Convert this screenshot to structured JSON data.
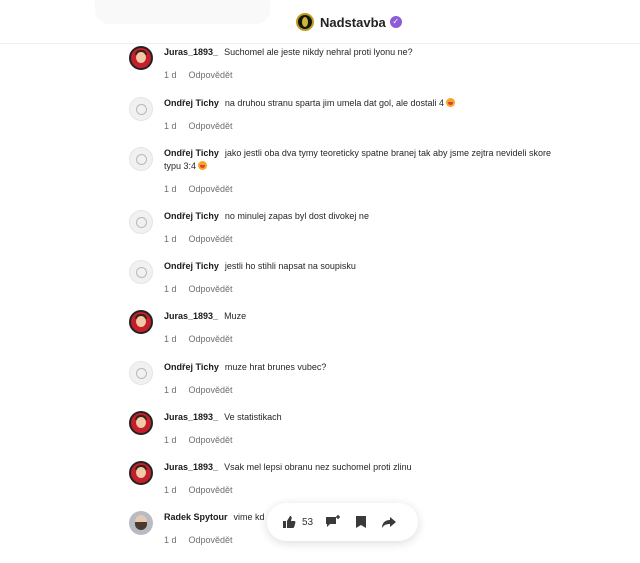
{
  "header": {
    "brand": "Nadstavba"
  },
  "comments": [
    {
      "author": "Juras_1893_",
      "text": "Suchomel ale jeste nikdy nehral proti lyonu ne?",
      "time": "1 d",
      "reply": "Odpovědět",
      "avatar": "red",
      "emoji": false
    },
    {
      "author": "Ondřej Tichy",
      "text": "na druhou stranu sparta jim umela dat gol, ale dostali 4",
      "time": "1 d",
      "reply": "Odpovědět",
      "avatar": "grey",
      "emoji": true
    },
    {
      "author": "Ondřej Tichy",
      "text": "jako jestli oba dva tymy teoreticky spatne branej tak aby jsme zejtra nevideli skore typu 3:4",
      "time": "1 d",
      "reply": "Odpovědět",
      "avatar": "grey",
      "emoji": true
    },
    {
      "author": "Ondřej Tichy",
      "text": "no minulej zapas byl dost divokej ne",
      "time": "1 d",
      "reply": "Odpovědět",
      "avatar": "grey",
      "emoji": false
    },
    {
      "author": "Ondřej Tichy",
      "text": "jestli ho stihli napsat na soupisku",
      "time": "1 d",
      "reply": "Odpovědět",
      "avatar": "grey",
      "emoji": false
    },
    {
      "author": "Juras_1893_",
      "text": "Muze",
      "time": "1 d",
      "reply": "Odpovědět",
      "avatar": "red",
      "emoji": false
    },
    {
      "author": "Ondřej Tichy",
      "text": "muze hrat brunes vubec?",
      "time": "1 d",
      "reply": "Odpovědět",
      "avatar": "grey",
      "emoji": false
    },
    {
      "author": "Juras_1893_",
      "text": "Ve statistikach",
      "time": "1 d",
      "reply": "Odpovědět",
      "avatar": "red",
      "emoji": false
    },
    {
      "author": "Juras_1893_",
      "text": "Vsak mel lepsi obranu nez suchomel proti zlinu",
      "time": "1 d",
      "reply": "Odpovědět",
      "avatar": "red",
      "emoji": false
    },
    {
      "author": "Radek Spytour",
      "text": "vime kd",
      "time": "1 d",
      "reply": "Odpovědět",
      "avatar": "photo",
      "emoji": false
    }
  ],
  "actionbar": {
    "like_count": "53"
  },
  "icons": {
    "like": "thumbs-up-icon",
    "comment": "comment-add-icon",
    "bookmark": "bookmark-icon",
    "share": "share-icon",
    "verified": "verified-badge-icon"
  }
}
